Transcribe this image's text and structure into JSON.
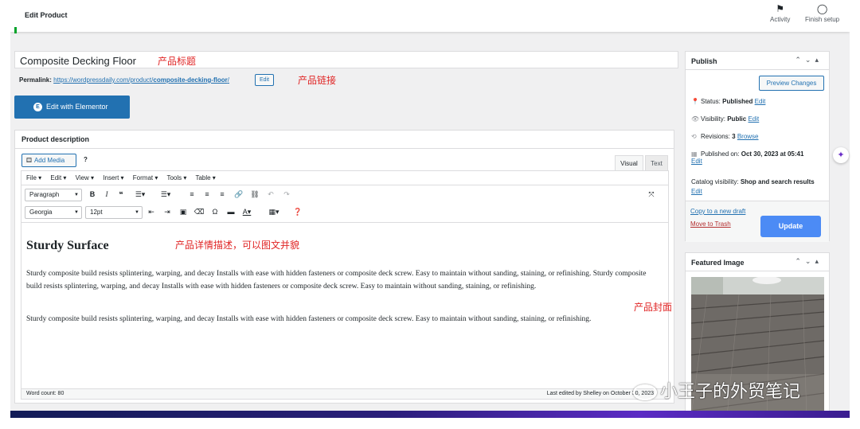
{
  "topbar": {
    "title": "Edit Product",
    "activity_label": "Activity",
    "finish_setup_label": "Finish setup"
  },
  "product": {
    "title": "Composite Decking Floor",
    "permalink_label": "Permalink:",
    "permalink_base": "https://wordpressdaily.com/product/",
    "permalink_slug": "composite-decking-floor",
    "permalink_tail": "/",
    "permalink_edit_label": "Edit"
  },
  "annotations": {
    "title": "产品标题",
    "link": "产品链接",
    "description": "产品详情描述，可以图文并貌",
    "cover": "产品封面"
  },
  "elementor": {
    "label": "Edit with Elementor"
  },
  "description_box": {
    "header": "Product description",
    "add_media": "Add Media",
    "help": "?",
    "tab_visual": "Visual",
    "tab_text": "Text",
    "menus": [
      "File ▾",
      "Edit ▾",
      "View ▾",
      "Insert ▾",
      "Format ▾",
      "Tools ▾",
      "Table ▾"
    ],
    "format_select": "Paragraph",
    "font_select": "Georgia",
    "size_select": "12pt",
    "heading": "Sturdy Surface",
    "paragraph1": "Sturdy composite build resists splintering, warping, and decay Installs with ease with hidden fasteners or composite deck screw. Easy to maintain without sanding, staining, or refinishing.  Sturdy composite build resists splintering, warping, and decay Installs with ease with hidden fasteners or composite deck screw. Easy to maintain without sanding, staining, or refinishing.",
    "paragraph2": "Sturdy composite build resists splintering, warping, and decay Installs with ease with hidden fasteners or composite deck screw. Easy to maintain without sanding, staining, or refinishing.",
    "word_count": "Word count: 80",
    "last_edited": "Last edited by Shelley on October 30, 2023"
  },
  "publish": {
    "title": "Publish",
    "preview": "Preview Changes",
    "status_label": "Status:",
    "status_value": "Published",
    "visibility_label": "Visibility:",
    "visibility_value": "Public",
    "revisions_label": "Revisions:",
    "revisions_value": "3",
    "browse": "Browse",
    "published_label": "Published on:",
    "published_value": "Oct 30, 2023 at 05:41",
    "edit": "Edit",
    "catalog_label": "Catalog visibility:",
    "catalog_value": "Shop and search results",
    "copy_draft": "Copy to a new draft",
    "move_trash": "Move to Trash",
    "update": "Update"
  },
  "featured": {
    "title": "Featured Image"
  },
  "watermark": "小王子的外贸笔记",
  "colors": {
    "accent": "#2271b1",
    "update_button": "#4c8bf5",
    "annotation": "#e02424",
    "trash": "#b32d2e"
  }
}
